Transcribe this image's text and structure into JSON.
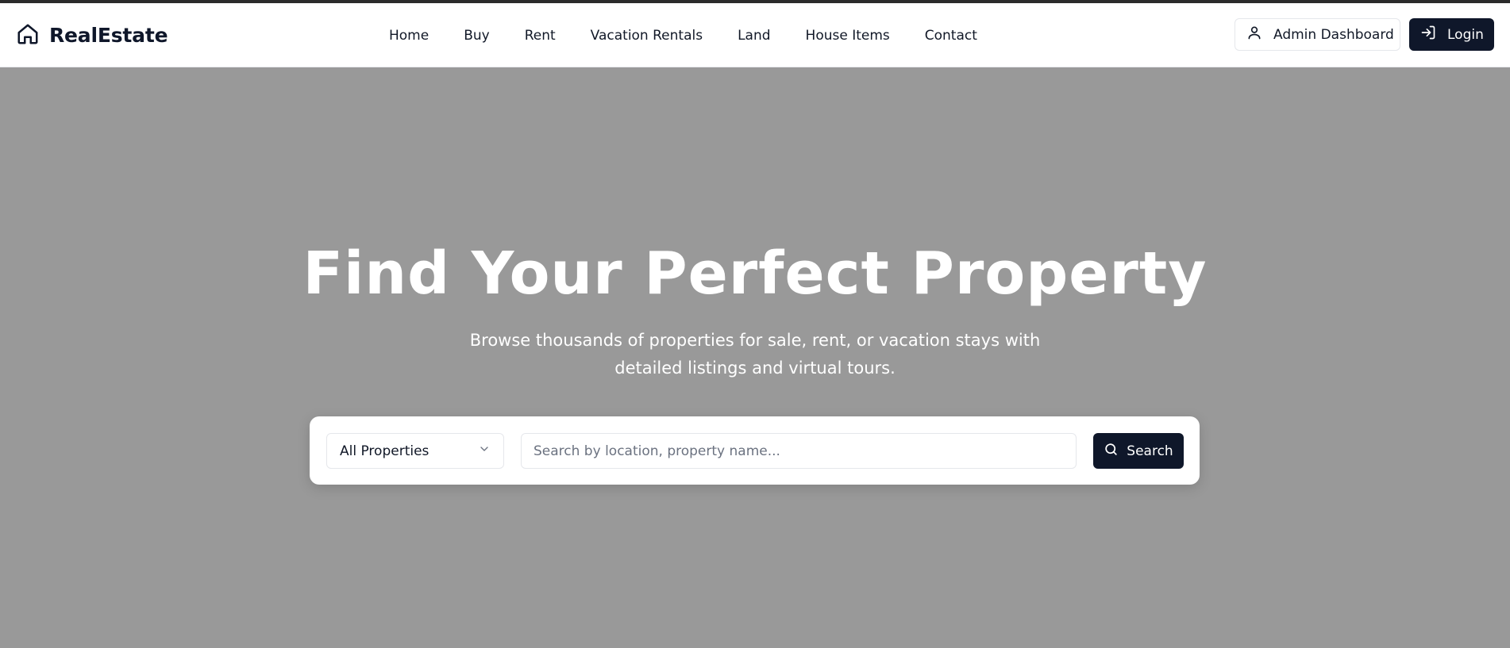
{
  "brand": {
    "name": "RealEstate",
    "icon": "home-icon"
  },
  "nav": {
    "links": [
      {
        "label": "Home"
      },
      {
        "label": "Buy"
      },
      {
        "label": "Rent"
      },
      {
        "label": "Vacation Rentals"
      },
      {
        "label": "Land"
      },
      {
        "label": "House Items"
      },
      {
        "label": "Contact"
      }
    ],
    "admin_label": "Admin Dashboard",
    "admin_icon": "user-icon",
    "login_label": "Login",
    "login_icon": "log-in-icon"
  },
  "hero": {
    "title": "Find Your Perfect Property",
    "subtitle": "Browse thousands of properties for sale, rent, or vacation stays with detailed listings and virtual tours."
  },
  "search": {
    "type_selected": "All Properties",
    "placeholder": "Search by location, property name...",
    "value": "",
    "button_label": "Search",
    "button_icon": "search-icon"
  },
  "colors": {
    "hero_bg": "#999999",
    "primary": "#0f172a",
    "white": "#ffffff",
    "border": "#e5e7eb"
  }
}
